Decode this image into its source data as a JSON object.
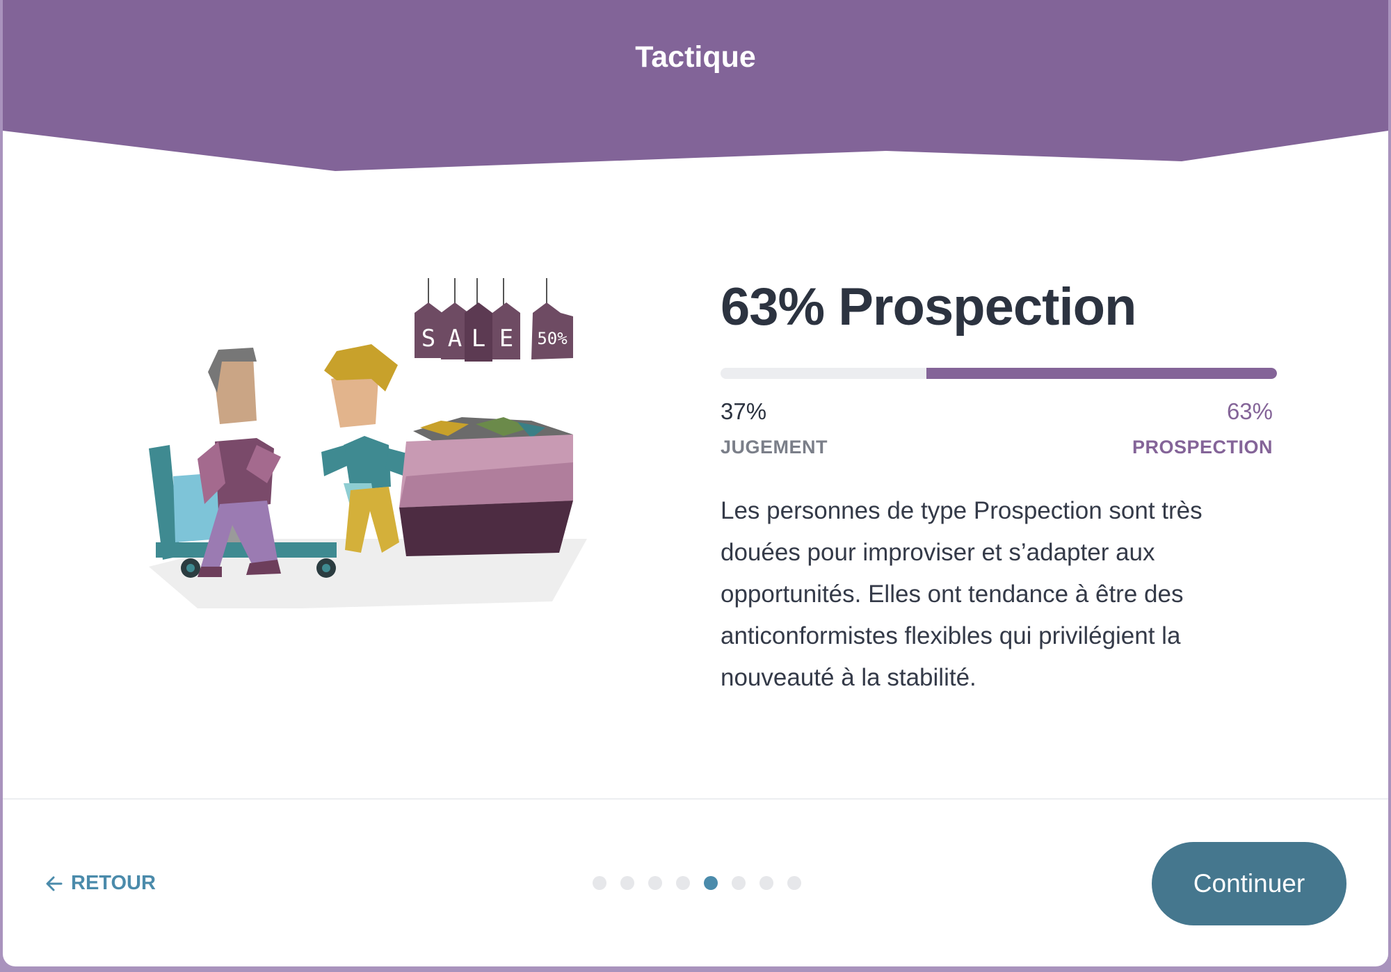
{
  "header": {
    "title": "Tactique",
    "band_color": "#826498"
  },
  "illustration": {
    "tags": [
      "S",
      "A",
      "L",
      "E",
      "50%"
    ]
  },
  "result": {
    "headline": "63% Prospection",
    "progress": 0.63,
    "left_percent": "37%",
    "left_label": "JUGEMENT",
    "right_percent": "63%",
    "right_label": "PROSPECTION",
    "description": "Les personnes de type Prospection sont très douées pour improviser et s’adapter aux opportunités. Elles ont tendance à être des anticonformistes flexibles qui privilégient la nouveauté à la stabilité."
  },
  "footer": {
    "back_label": "RETOUR",
    "back_icon": "arrow-left-icon",
    "continue_label": "Continuer",
    "step_count": 8,
    "current_step": 5,
    "accent_color": "#4b8bab"
  }
}
